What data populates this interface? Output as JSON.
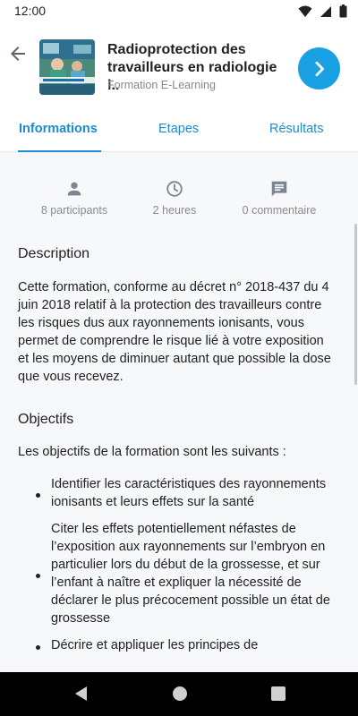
{
  "status_bar": {
    "time": "12:00"
  },
  "header": {
    "title": "Radioprotection des travailleurs en radiologie i..",
    "subtitle": "Formation E-Learning"
  },
  "tabs": [
    {
      "label": "Informations",
      "active": true
    },
    {
      "label": "Etapes",
      "active": false
    },
    {
      "label": "Résultats",
      "active": false
    }
  ],
  "stats": [
    {
      "icon": "person-icon",
      "label": "8 participants"
    },
    {
      "icon": "clock-icon",
      "label": "2 heures"
    },
    {
      "icon": "comment-icon",
      "label": "0 commentaire"
    }
  ],
  "description": {
    "title": "Description",
    "text": "Cette formation, conforme au décret n° 2018-437 du 4 juin 2018 relatif à la protection des travailleurs contre les risques dus aux rayonnements ionisants, vous permet de comprendre le risque lié à votre exposition et les moyens de diminuer autant que possible la dose que vous recevez."
  },
  "objectives": {
    "title": "Objectifs",
    "intro": "Les objectifs de la formation sont les suivants :",
    "items": [
      "Identifier les caractéristiques des rayonnements ionisants et leurs effets sur la santé",
      "Citer les effets potentiellement néfastes de l’exposition aux rayonnements sur l’embryon en particulier lors du début de la grossesse, et sur l’enfant à naître et expliquer la nécessité de déclarer le plus précocement possible un état de grossesse",
      "Décrire et appliquer les principes de"
    ]
  },
  "colors": {
    "accent": "#1a8ccf",
    "next_button": "#1aa1e3",
    "content_background": "#f7f8fa"
  }
}
